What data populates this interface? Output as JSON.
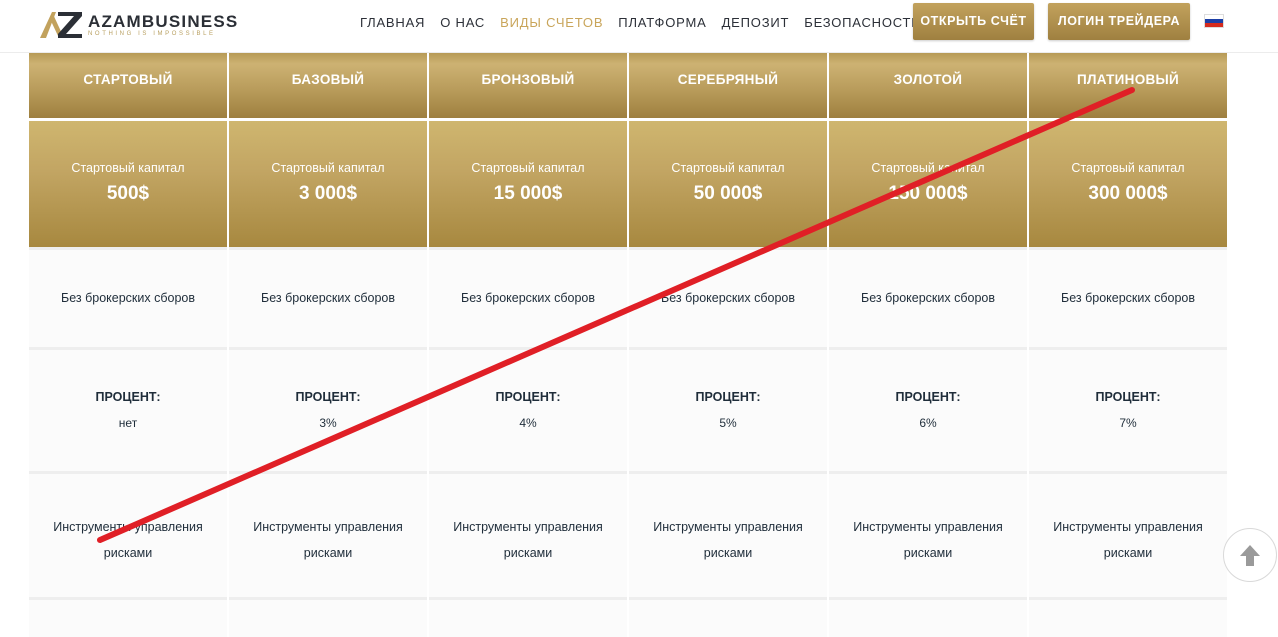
{
  "brand": {
    "name": "AZAMBUSINESS",
    "tagline": "NOTHING IS IMPOSSIBLE",
    "accent": "#c9a55a"
  },
  "nav": {
    "items": [
      {
        "label": "ГЛАВНАЯ"
      },
      {
        "label": "О НАС"
      },
      {
        "label": "ВИДЫ СЧЕТОВ",
        "active": true
      },
      {
        "label": "ПЛАТФОРМА"
      },
      {
        "label": "ДЕПОЗИТ"
      },
      {
        "label": "БЕЗОПАСНОСТЬ"
      }
    ],
    "open_account": "ОТКРЫТЬ СЧЁТ",
    "trader_login": "ЛОГИН ТРЕЙДЕРА",
    "language_flag": "russian-flag-icon"
  },
  "accounts": {
    "columns": [
      {
        "name": "СТАРТОВЫЙ",
        "capital_label": "Стартовый капитал",
        "capital": "500$",
        "fees": "Без брокерских сборов",
        "percent_label": "ПРОЦЕНТ:",
        "percent": "нет",
        "tools": "Инструменты управления рисками"
      },
      {
        "name": "БАЗОВЫЙ",
        "capital_label": "Стартовый капитал",
        "capital": "3 000$",
        "fees": "Без брокерских сборов",
        "percent_label": "ПРОЦЕНТ:",
        "percent": "3%",
        "tools": "Инструменты управления рисками"
      },
      {
        "name": "БРОНЗОВЫЙ",
        "capital_label": "Стартовый капитал",
        "capital": "15 000$",
        "fees": "Без брокерских сборов",
        "percent_label": "ПРОЦЕНТ:",
        "percent": "4%",
        "tools": "Инструменты управления рисками"
      },
      {
        "name": "СЕРЕБРЯНЫЙ",
        "capital_label": "Стартовый капитал",
        "capital": "50 000$",
        "fees": "Без брокерских сборов",
        "percent_label": "ПРОЦЕНТ:",
        "percent": "5%",
        "tools": "Инструменты управления рисками"
      },
      {
        "name": "ЗОЛОТОЙ",
        "capital_label": "Стартовый капитал",
        "capital": "150 000$",
        "fees": "Без брокерских сборов",
        "percent_label": "ПРОЦЕНТ:",
        "percent": "6%",
        "tools": "Инструменты управления рисками"
      },
      {
        "name": "ПЛАТИНОВЫЙ",
        "capital_label": "Стартовый капитал",
        "capital": "300 000$",
        "fees": "Без брокерских сборов",
        "percent_label": "ПРОЦЕНТ:",
        "percent": "7%",
        "tools": "Инструменты управления рисками"
      }
    ]
  },
  "scroll_top_icon": "arrow-up-icon",
  "overlay": {
    "color": "#e01f26"
  }
}
